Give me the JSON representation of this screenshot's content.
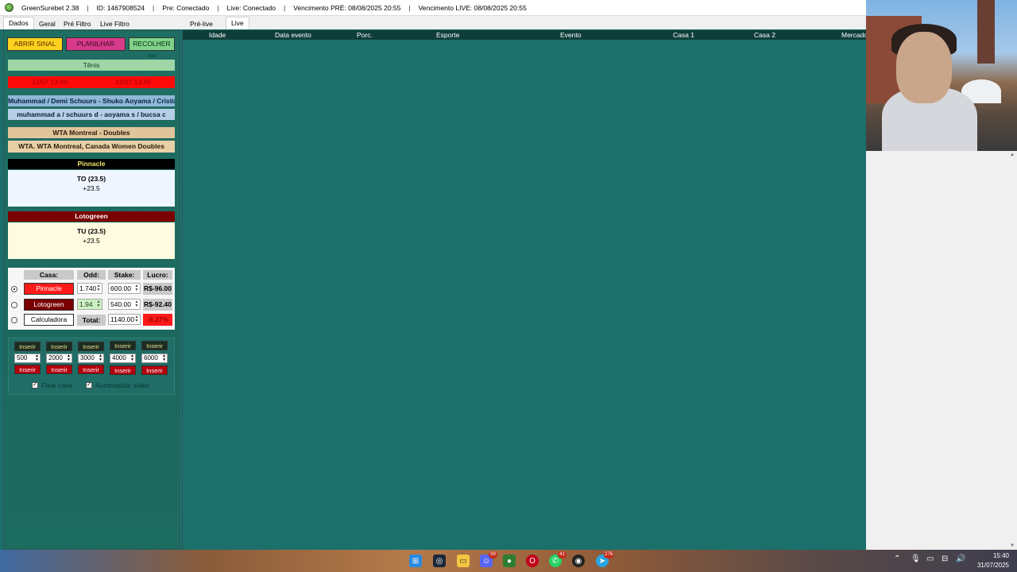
{
  "titlebar": {
    "app": "GreenSurebet 2.38",
    "id": "ID: 1467908524",
    "pre": "Pre: Conectado",
    "live": "Live: Conectado",
    "venc_pre": "Vencimento PRÉ: 08/08/2025 20:55",
    "venc_live": "Vencimento LIVE: 08/08/2025 20:55",
    "sep": "|"
  },
  "left_tabs": [
    "Dados",
    "Geral",
    "Pré Filtro",
    "Live Filtro"
  ],
  "main_tabs": [
    "Pré-live",
    "Live"
  ],
  "actions": {
    "abrir": "ABRIR SINAL",
    "planilhar": "PLANILHAR",
    "recolher": "RECOLHER <<"
  },
  "sport": "Tênis",
  "times": [
    "31/07 13:40",
    "31/07 13:45"
  ],
  "event_name": "Muhammad / Demi Schuurs - Shuko Aoyama / Cristina B",
  "event_name_alt": "muhammad a / schuurs d - aoyama s / bucsa c",
  "league": "WTA Montreal - Doubles",
  "league_alt": "WTA. WTA Montreal, Canada Women Doubles",
  "bet1": {
    "house": "Pinnacle",
    "market": "TO (23.5)",
    "line": "+23.5"
  },
  "bet2": {
    "house": "Lotogreen",
    "market": "TU (23.5)",
    "line": "+23.5"
  },
  "calculator": {
    "headers": {
      "casa": "Casa:",
      "odd": "Odd:",
      "stake": "Stake:",
      "lucro": "Lucro:"
    },
    "rows": [
      {
        "house": "Pinnacle",
        "odd": "1.740",
        "stake": "600.00",
        "lucro": "R$-96.00"
      },
      {
        "house": "Lotogreen",
        "odd": "1.94",
        "stake": "540.00",
        "lucro": "R$-92.40"
      }
    ],
    "calc_label": "Calculadora",
    "total_label": "Total:",
    "total": "1140.00",
    "percent": "-8.27%"
  },
  "quick_stakes": {
    "insert_label": "Inserir",
    "values": [
      "500",
      "2000",
      "3000",
      "4000",
      "6000"
    ]
  },
  "options": {
    "fixar": "Fixar casa",
    "automatizar": "Automatizar stake"
  },
  "grid_columns": [
    "Idade",
    "Data evento",
    "Porc.",
    "Esporte",
    "Evento",
    "Casa 1",
    "Casa 2",
    "Mercado"
  ],
  "taskbar": {
    "time": "15:40",
    "date": "31/07/2025",
    "badges": {
      "discord": "99",
      "whatsapp": "41",
      "telegram": "276"
    }
  },
  "colors": {
    "teal": "#1c706b",
    "red": "#ff0000",
    "darkred": "#7a0000",
    "yellow": "#ffd21e",
    "pink": "#d63a8a"
  }
}
